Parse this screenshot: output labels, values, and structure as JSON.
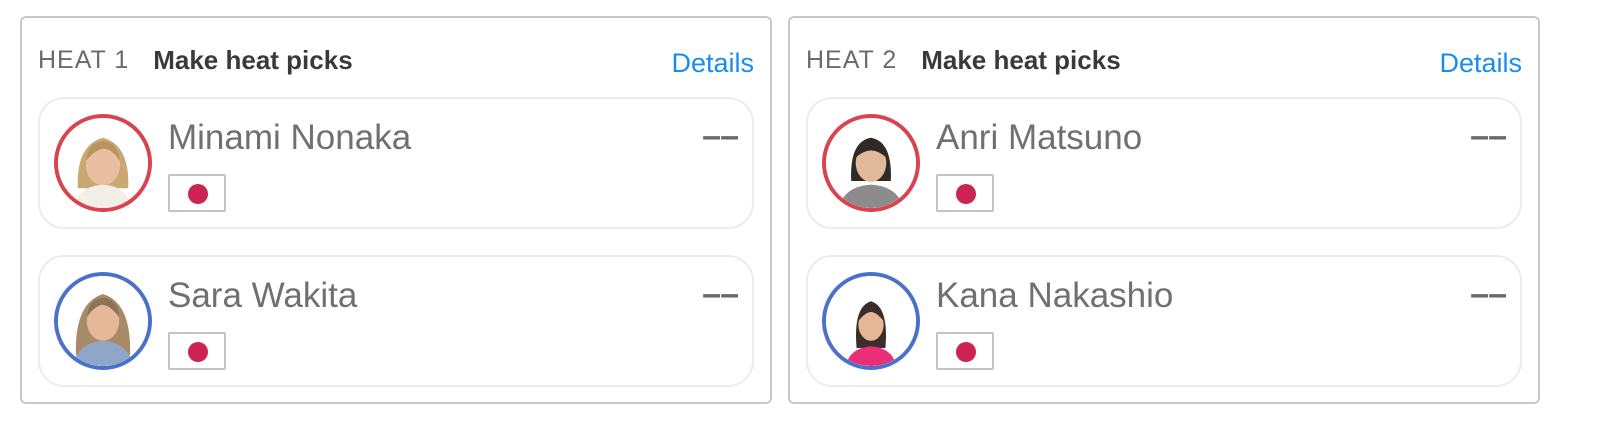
{
  "heats": [
    {
      "label": "HEAT 1",
      "title": "Make heat picks",
      "details_label": "Details",
      "surfers": [
        {
          "name": "Minami Nonaka",
          "score": "––",
          "ring_color": "#d9434e",
          "country_flag": "japan-flag",
          "avatar": "surfer-photo"
        },
        {
          "name": "Sara Wakita",
          "score": "––",
          "ring_color": "#4a72c9",
          "country_flag": "japan-flag",
          "avatar": "surfer-photo"
        }
      ]
    },
    {
      "label": "HEAT 2",
      "title": "Make heat picks",
      "details_label": "Details",
      "surfers": [
        {
          "name": "Anri Matsuno",
          "score": "––",
          "ring_color": "#d9434e",
          "country_flag": "japan-flag",
          "avatar": "surfer-photo"
        },
        {
          "name": "Kana Nakashio",
          "score": "––",
          "ring_color": "#4a72c9",
          "country_flag": "japan-flag",
          "avatar": "surfer-photo"
        }
      ]
    }
  ],
  "colors": {
    "link": "#1a8cf0",
    "ring_red": "#d9434e",
    "ring_blue": "#4a72c9",
    "flag_disc": "#cc2452"
  }
}
